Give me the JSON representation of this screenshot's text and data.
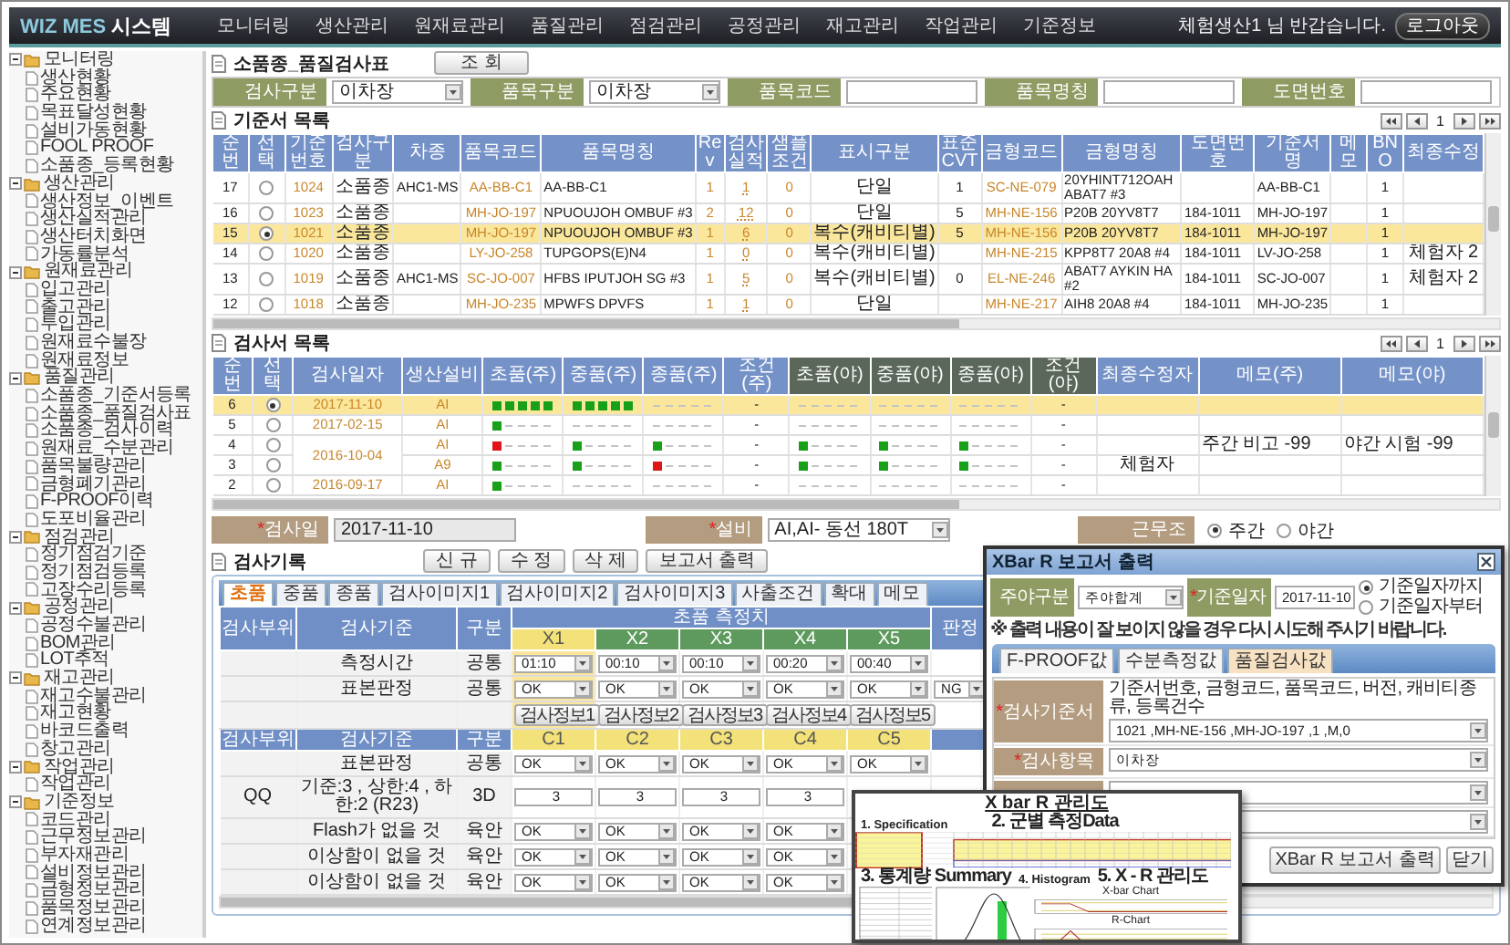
{
  "nav": {
    "logo": "WIZ MES",
    "logo_suffix": "시스템",
    "menus": [
      "모니터링",
      "생산관리",
      "원재료관리",
      "품질관리",
      "점검관리",
      "공정관리",
      "재고관리",
      "작업관리",
      "기준정보"
    ],
    "greeting": "체험생산1 님 반갑습니다.",
    "logout": "로그아웃"
  },
  "sidebar": {
    "items": [
      {
        "label": "모니터링",
        "expanded": true,
        "children": [
          {
            "label": "생산현황"
          },
          {
            "label": "주요현황"
          },
          {
            "label": "목표달성현황"
          },
          {
            "label": "설비가동현황"
          },
          {
            "label": "FOOL PROOF"
          },
          {
            "label": "소품종_등록현황"
          }
        ]
      },
      {
        "label": "생산관리",
        "expanded": true,
        "children": [
          {
            "label": "생산정보_이벤트"
          },
          {
            "label": "생산실적관리"
          },
          {
            "label": "생산터치화면"
          },
          {
            "label": "가동률분석"
          }
        ]
      },
      {
        "label": "원재료관리",
        "expanded": true,
        "children": [
          {
            "label": "입고관리"
          },
          {
            "label": "출고관리"
          },
          {
            "label": "투입관리"
          },
          {
            "label": "원재료수불장"
          },
          {
            "label": "원재료정보"
          }
        ]
      },
      {
        "label": "품질관리",
        "expanded": true,
        "children": [
          {
            "label": "소품종_기준서등록"
          },
          {
            "label": "소품종_품질검사표"
          },
          {
            "label": "소품종_검사이력"
          },
          {
            "label": "원재료_수분관리"
          },
          {
            "label": "품목불량관리"
          },
          {
            "label": "금형폐기관리"
          },
          {
            "label": "F-PROOF이력"
          },
          {
            "label": "도포비율관리"
          }
        ]
      },
      {
        "label": "점검관리",
        "expanded": true,
        "children": [
          {
            "label": "정기점검기준"
          },
          {
            "label": "정기점검등록"
          },
          {
            "label": "고장수리등록"
          }
        ]
      },
      {
        "label": "공정관리",
        "expanded": true,
        "children": [
          {
            "label": "공정수불관리"
          },
          {
            "label": "BOM관리"
          },
          {
            "label": "LOT추적"
          }
        ]
      },
      {
        "label": "재고관리",
        "expanded": true,
        "children": [
          {
            "label": "재고수불관리"
          },
          {
            "label": "재고현황"
          },
          {
            "label": "바코드출력"
          },
          {
            "label": "창고관리"
          }
        ]
      },
      {
        "label": "작업관리",
        "expanded": true,
        "children": [
          {
            "label": "작업관리"
          }
        ]
      },
      {
        "label": "기준정보",
        "expanded": true,
        "children": [
          {
            "label": "코드관리"
          },
          {
            "label": "근무정보관리"
          },
          {
            "label": "부자재관리"
          },
          {
            "label": "설비정보관리"
          },
          {
            "label": "금형정보관리"
          },
          {
            "label": "품목정보관리"
          },
          {
            "label": "연계정보관리"
          }
        ]
      }
    ]
  },
  "page": {
    "title": "소품종_품질검사표",
    "search_button": "조 회"
  },
  "filters": [
    {
      "kind": "select",
      "label": "검사구분",
      "value": "이차장"
    },
    {
      "kind": "select",
      "label": "품목구분",
      "value": "이차장"
    },
    {
      "kind": "input",
      "label": "품목코드"
    },
    {
      "kind": "input",
      "label": "품목명칭"
    },
    {
      "kind": "input",
      "label": "도면번호"
    }
  ],
  "standards": {
    "title": "기준서 목록",
    "page": "1",
    "columns": [
      "순번",
      "선택",
      "기준번호",
      "검사구분",
      "차종",
      "품목코드",
      "품목명칭",
      "Rev",
      "검사실적",
      "샘플조건",
      "표시구분",
      "표준CVT",
      "금형코드",
      "금형명칭",
      "도면번호",
      "기준서명",
      "메모",
      "BNO",
      "최종수정"
    ],
    "rows": [
      {
        "selected": false,
        "cells": [
          "17",
          "",
          "1024",
          "소품종",
          "AHC1-MS",
          "AA-BB-C1",
          "AA-BB-C1",
          "1",
          "1",
          "0",
          "단일",
          "1",
          "SC-NE-079",
          "20YHINT712OAH ABAT7 #3",
          "",
          "AA-BB-C1",
          "",
          "1",
          ""
        ]
      },
      {
        "selected": false,
        "cells": [
          "16",
          "",
          "1023",
          "소품종",
          "",
          "MH-JO-197",
          "NPUOUJOH OMBUF #3",
          "2",
          "12",
          "0",
          "단일",
          "5",
          "MH-NE-156",
          "P20B 20YV8T7",
          "184-1011",
          "MH-JO-197",
          "",
          "1",
          ""
        ]
      },
      {
        "selected": true,
        "cells": [
          "15",
          "",
          "1021",
          "소품종",
          "",
          "MH-JO-197",
          "NPUOUJOH OMBUF #3",
          "1",
          "6",
          "0",
          "복수(캐비티별)",
          "5",
          "MH-NE-156",
          "P20B 20YV8T7",
          "184-1011",
          "MH-JO-197",
          "",
          "1",
          ""
        ]
      },
      {
        "selected": false,
        "cells": [
          "14",
          "",
          "1020",
          "소품종",
          "",
          "LY-JO-258",
          "TUPGOPS(E)N4",
          "1",
          "0",
          "0",
          "복수(캐비티별)",
          "",
          "MH-NE-215",
          "KPP8T7 20A8 #4",
          "184-1011",
          "LV-JO-258",
          "",
          "1",
          "체험자 2"
        ]
      },
      {
        "selected": false,
        "cells": [
          "13",
          "",
          "1019",
          "소품종",
          "AHC1-MS",
          "SC-JO-007",
          "HFBS IPUTJOH SG #3",
          "1",
          "5",
          "0",
          "복수(캐비티별)",
          "0",
          "EL-NE-246",
          "ABAT7 AYKIN HA #2",
          "184-1011",
          "SC-JO-007",
          "",
          "1",
          "체험자 2"
        ]
      },
      {
        "selected": false,
        "cells": [
          "12",
          "",
          "1018",
          "소품종",
          "",
          "MH-JO-235",
          "MPWFS DPVFS",
          "1",
          "1",
          "0",
          "단일",
          "",
          "MH-NE-217",
          "AIH8 20A8 #4",
          "184-1011",
          "MH-JO-235",
          "",
          "1",
          ""
        ]
      }
    ]
  },
  "inspections": {
    "title": "검사서 목록",
    "page": "1",
    "columns": [
      {
        "label": "순번",
        "kind": "day"
      },
      {
        "label": "선택",
        "kind": "day"
      },
      {
        "label": "검사일자",
        "kind": "day"
      },
      {
        "label": "생산설비",
        "kind": "day"
      },
      {
        "label": "초품(주)",
        "kind": "day"
      },
      {
        "label": "중품(주)",
        "kind": "day"
      },
      {
        "label": "종품(주)",
        "kind": "day"
      },
      {
        "label": "조건(주)",
        "kind": "day"
      },
      {
        "label": "초품(야)",
        "kind": "night"
      },
      {
        "label": "중품(야)",
        "kind": "night"
      },
      {
        "label": "종품(야)",
        "kind": "night"
      },
      {
        "label": "조건(야)",
        "kind": "night"
      },
      {
        "label": "최종수정자",
        "kind": "day"
      },
      {
        "label": "메모(주)",
        "kind": "day"
      },
      {
        "label": "메모(야)",
        "kind": "day"
      }
    ],
    "rows": [
      {
        "selected": true,
        "no": "6",
        "date": "2017-11-10",
        "equipment": "AI",
        "day": [
          {
            "level": 1,
            "kind": "ok"
          },
          {
            "level": 1,
            "kind": "ok"
          },
          {
            "kind": "empty"
          }
        ],
        "day_condition": "-",
        "night": [
          {
            "kind": "empty"
          },
          {
            "kind": "empty"
          },
          {
            "kind": "empty"
          }
        ],
        "night_condition": "-"
      },
      {
        "selected": false,
        "no": "5",
        "date": "2017-02-15",
        "equipment": "AI",
        "day": [
          {
            "level": 0.2,
            "kind": "ok"
          },
          {
            "kind": "empty"
          },
          {
            "kind": "empty"
          }
        ],
        "day_condition": "-",
        "night": [
          {
            "kind": "empty"
          },
          {
            "kind": "empty"
          },
          {
            "kind": "empty"
          }
        ],
        "night_condition": "-"
      },
      {
        "selected": false,
        "no": "4",
        "date": "2016-10-04",
        "equipment": "AI",
        "day": [
          {
            "level": 0.2,
            "kind": "ng"
          },
          {
            "level": 0.2,
            "kind": "ok"
          },
          {
            "level": 0.2,
            "kind": "ok"
          }
        ],
        "day_condition": "-",
        "night": [
          {
            "level": 0.2,
            "kind": "ok"
          },
          {
            "level": 0.2,
            "kind": "ok"
          },
          {
            "level": 0.2,
            "kind": "ok"
          }
        ],
        "night_condition": "-",
        "memo_day": "주간 비고 -99",
        "memo_night": "야간 시험 -99"
      },
      {
        "selected": false,
        "no": "3",
        "equipment": "A9",
        "day": [
          {
            "level": 0.2,
            "kind": "ok"
          },
          {
            "level": 0.2,
            "kind": "ok"
          },
          {
            "level": 0.2,
            "kind": "ng"
          }
        ],
        "day_condition": "-",
        "night": [
          {
            "level": 0.2,
            "kind": "ok"
          },
          {
            "level": 0.2,
            "kind": "ok"
          },
          {
            "level": 0.2,
            "kind": "ok"
          }
        ],
        "night_condition": "-",
        "editor": "체험자"
      },
      {
        "selected": false,
        "no": "2",
        "date": "2016-09-17",
        "equipment": "AI",
        "day": [
          {
            "level": 0.2,
            "kind": "ok"
          },
          {
            "kind": "empty"
          },
          {
            "kind": "empty"
          }
        ],
        "day_condition": "-",
        "night": [
          {
            "kind": "empty"
          },
          {
            "kind": "empty"
          },
          {
            "kind": "empty"
          }
        ],
        "night_condition": "-"
      }
    ]
  },
  "inspection_form": {
    "fields": [
      {
        "kind": "input",
        "mark": "*",
        "label": "검사일",
        "value": "2017-11-10"
      },
      {
        "kind": "select",
        "mark": "*",
        "label": "설비",
        "value": "AI,AI- 동선 180T"
      },
      {
        "kind": "radio",
        "label": "근무조",
        "options": [
          {
            "label": "주간",
            "selected": true
          },
          {
            "label": "야간",
            "selected": false
          }
        ]
      }
    ]
  },
  "record": {
    "title": "검사기록",
    "buttons": [
      "신 규",
      "수 정",
      "삭 제",
      "보고서 출력"
    ],
    "tabs": [
      {
        "label": "초품",
        "selected": true
      },
      {
        "label": "중품",
        "selected": false
      },
      {
        "label": "종품",
        "selected": false
      },
      {
        "label": "검사이미지1",
        "selected": false
      },
      {
        "label": "검사이미지2",
        "selected": false
      },
      {
        "label": "검사이미지3",
        "selected": false
      },
      {
        "label": "사출조건",
        "selected": false
      },
      {
        "label": "확대",
        "selected": false
      },
      {
        "label": "메모",
        "selected": false
      }
    ],
    "columns": [
      "검사부위",
      "검사기준",
      "구분"
    ],
    "group_label": "초품 측정치",
    "verdict_label": "판정",
    "points": [
      {
        "label": "X1",
        "selected": true
      },
      {
        "label": "X2",
        "selected": false
      },
      {
        "label": "X3",
        "selected": false
      },
      {
        "label": "X4",
        "selected": false
      },
      {
        "label": "X5",
        "selected": false
      }
    ],
    "rows": [
      {
        "kind": "select",
        "standard": "측정시간",
        "type": "공통",
        "values": [
          "01:10",
          "00:10",
          "00:10",
          "00:20",
          "00:40"
        ]
      },
      {
        "kind": "select",
        "standard": "표본판정",
        "type": "공통",
        "values": [
          "OK",
          "OK",
          "OK",
          "OK",
          "OK"
        ],
        "verdict": "NG"
      },
      {
        "kind": "button",
        "values": [
          "검사정보1",
          "검사정보2",
          "검사정보3",
          "검사정보4",
          "검사정보5"
        ]
      }
    ],
    "sub_columns": [
      "검사부위",
      "검사기준",
      "구분"
    ],
    "cavities": [
      "C1",
      "C2",
      "C3",
      "C4",
      "C5"
    ],
    "sub_rows": [
      {
        "kind": "select",
        "standard": "표본판정",
        "type": "공통",
        "values": [
          "OK",
          "OK",
          "OK",
          "OK",
          "OK"
        ]
      },
      {
        "kind": "input",
        "part": "QQ",
        "standard": "기준:3 , 상한:4 , 하한:2 (R23)",
        "type": "3D",
        "values": [
          "3",
          "3",
          "3",
          "3"
        ]
      },
      {
        "kind": "select",
        "standard": "Flash가 없을 것",
        "type": "육안",
        "values": [
          "OK",
          "OK",
          "OK",
          "OK"
        ]
      },
      {
        "kind": "select",
        "standard": "이상함이 없을 것",
        "type": "육안",
        "values": [
          "OK",
          "OK",
          "OK",
          "OK"
        ]
      },
      {
        "kind": "select",
        "standard": "이상함이 없을 것",
        "type": "육안",
        "values": [
          "OK",
          "OK",
          "OK",
          "OK"
        ]
      }
    ]
  },
  "report_dialog": {
    "title": "XBar R 보고서 출력",
    "fields": [
      {
        "kind": "select",
        "label": "주야구분",
        "value": "주야합계"
      },
      {
        "kind": "input",
        "mark": "*",
        "label": "기준일자",
        "value": "2017-11-10"
      },
      {
        "kind": "radio",
        "options": [
          {
            "label": "기준일자까지",
            "selected": true
          },
          {
            "label": "기준일자부터",
            "selected": false
          }
        ]
      }
    ],
    "note": "※ 출력 내용이 잘 보이지 않을 경우 다시 시도해 주시기 바랍니다.",
    "tabs": [
      {
        "label": "F-PROOF값",
        "selected": false
      },
      {
        "label": "수분측정값",
        "selected": false
      },
      {
        "label": "품질검사값",
        "selected": true
      }
    ],
    "selects": [
      {
        "kind": "select",
        "mark": "*",
        "label": "검사기준서",
        "hint": "기준서번호, 금형코드, 품목코드, 버전, 캐비티종류, 등록건수",
        "value": "1021 ,MH-NE-156 ,MH-JO-197 ,1 ,M,0"
      },
      {
        "kind": "select",
        "mark": "*",
        "label": "검사항목",
        "value": "이차장"
      },
      {
        "kind": "select"
      },
      {
        "kind": "select"
      }
    ],
    "buttons": [
      "XBar R 보고서 출력",
      "닫기"
    ]
  },
  "report_preview": {
    "title": "X bar R 관리도",
    "sections": [
      "1. Specification",
      "2. 군별 측정Data",
      "3. 통계량 Summary",
      "4. Histogram",
      "5. X - R 관리도"
    ],
    "charts": [
      "X-bar Chart",
      "R-Chart"
    ]
  }
}
